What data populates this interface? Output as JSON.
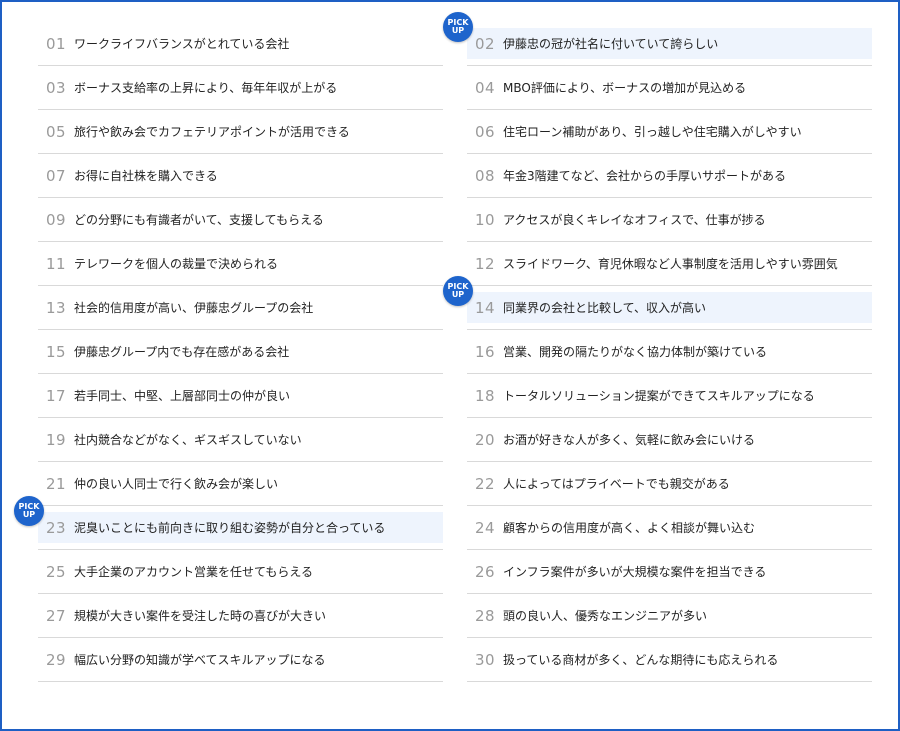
{
  "badge_label": "PICK UP",
  "accent_color": "#1e64cc",
  "highlight_color": "#eef4fd",
  "items": [
    {
      "num": "01",
      "text": "ワークライフバランスがとれている会社",
      "pick": false
    },
    {
      "num": "02",
      "text": "伊藤忠の冠が社名に付いていて誇らしい",
      "pick": true
    },
    {
      "num": "03",
      "text": "ボーナス支給率の上昇により、毎年年収が上がる",
      "pick": false
    },
    {
      "num": "04",
      "text": "MBO評価により、ボーナスの増加が見込める",
      "pick": false
    },
    {
      "num": "05",
      "text": "旅行や飲み会でカフェテリアポイントが活用できる",
      "pick": false
    },
    {
      "num": "06",
      "text": "住宅ローン補助があり、引っ越しや住宅購入がしやすい",
      "pick": false
    },
    {
      "num": "07",
      "text": "お得に自社株を購入できる",
      "pick": false
    },
    {
      "num": "08",
      "text": "年金3階建てなど、会社からの手厚いサポートがある",
      "pick": false
    },
    {
      "num": "09",
      "text": "どの分野にも有識者がいて、支援してもらえる",
      "pick": false
    },
    {
      "num": "10",
      "text": "アクセスが良くキレイなオフィスで、仕事が捗る",
      "pick": false
    },
    {
      "num": "11",
      "text": "テレワークを個人の裁量で決められる",
      "pick": false
    },
    {
      "num": "12",
      "text": "スライドワーク、育児休暇など人事制度を活用しやすい雰囲気",
      "pick": false
    },
    {
      "num": "13",
      "text": "社会的信用度が高い、伊藤忠グループの会社",
      "pick": false
    },
    {
      "num": "14",
      "text": "同業界の会社と比較して、収入が高い",
      "pick": true
    },
    {
      "num": "15",
      "text": "伊藤忠グループ内でも存在感がある会社",
      "pick": false
    },
    {
      "num": "16",
      "text": "営業、開発の隔たりがなく協力体制が築けている",
      "pick": false
    },
    {
      "num": "17",
      "text": "若手同士、中堅、上層部同士の仲が良い",
      "pick": false
    },
    {
      "num": "18",
      "text": "トータルソリューション提案ができてスキルアップになる",
      "pick": false
    },
    {
      "num": "19",
      "text": "社内競合などがなく、ギスギスしていない",
      "pick": false
    },
    {
      "num": "20",
      "text": "お酒が好きな人が多く、気軽に飲み会にいける",
      "pick": false
    },
    {
      "num": "21",
      "text": "仲の良い人同士で行く飲み会が楽しい",
      "pick": false
    },
    {
      "num": "22",
      "text": "人によってはプライベートでも親交がある",
      "pick": false
    },
    {
      "num": "23",
      "text": "泥臭いことにも前向きに取り組む姿勢が自分と合っている",
      "pick": true
    },
    {
      "num": "24",
      "text": "顧客からの信用度が高く、よく相談が舞い込む",
      "pick": false
    },
    {
      "num": "25",
      "text": "大手企業のアカウント営業を任せてもらえる",
      "pick": false
    },
    {
      "num": "26",
      "text": "インフラ案件が多いが大規模な案件を担当できる",
      "pick": false
    },
    {
      "num": "27",
      "text": "規模が大きい案件を受注した時の喜びが大きい",
      "pick": false
    },
    {
      "num": "28",
      "text": "頭の良い人、優秀なエンジニアが多い",
      "pick": false
    },
    {
      "num": "29",
      "text": "幅広い分野の知識が学べてスキルアップになる",
      "pick": false
    },
    {
      "num": "30",
      "text": "扱っている商材が多く、どんな期待にも応えられる",
      "pick": false
    }
  ]
}
